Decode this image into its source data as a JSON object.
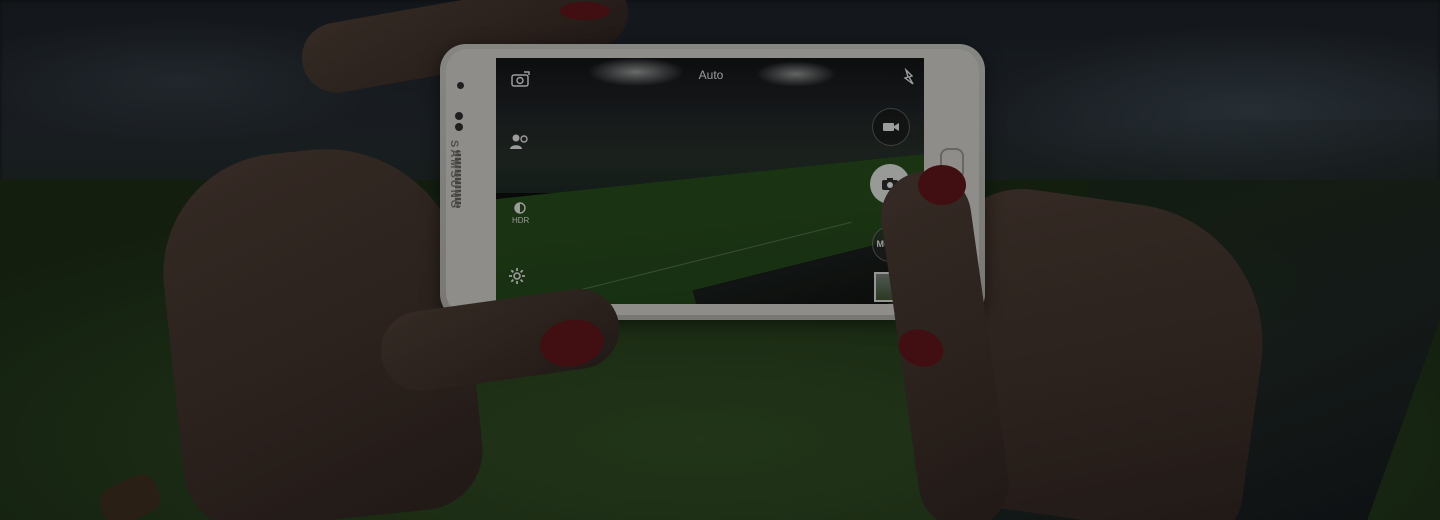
{
  "scene": {
    "description_visible_text": true
  },
  "phone": {
    "brand_text": "SAMSUNG"
  },
  "camera_ui": {
    "mode_label": "Auto",
    "mode_button_label": "MODE",
    "hdr_label": "HDR",
    "icons": {
      "switch_camera": "switch-camera-icon",
      "effects": "effects-icon",
      "hdr": "hdr-icon",
      "settings": "settings-icon",
      "flash": "flash-icon",
      "video": "video-icon",
      "shutter": "camera-icon"
    },
    "colors": {
      "ui_text": "#d8d8d8",
      "shutter_fill": "#e6e6e6",
      "nail_polish": "#5b1418"
    }
  }
}
